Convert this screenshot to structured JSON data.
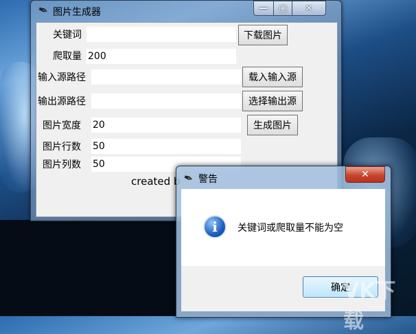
{
  "main_window": {
    "title": "图片生成器",
    "controls": {
      "minimize": "—",
      "maximize": "▢",
      "close": "✕"
    },
    "fields": {
      "keyword": {
        "label": "关键词",
        "value": ""
      },
      "crawl_count": {
        "label": "爬取量",
        "value": "200"
      },
      "input_path": {
        "label": "输入源路径",
        "value": ""
      },
      "output_path": {
        "label": "输出源路径",
        "value": ""
      },
      "image_width": {
        "label": "图片宽度",
        "value": "20"
      },
      "image_rows": {
        "label": "图片行数",
        "value": "50"
      },
      "image_cols": {
        "label": "图片列数",
        "value": "50"
      }
    },
    "buttons": {
      "download": "下载图片",
      "load_input": "载入输入源",
      "select_output": "选择输出源",
      "generate": "生成图片"
    },
    "credit": "created b"
  },
  "dialog": {
    "title": "警告",
    "close": "✕",
    "message": "关键词或爬取量不能为空",
    "info_glyph": "i",
    "ok": "确定"
  },
  "icons": {
    "app": "feather-icon",
    "dialog_info": "info-icon"
  },
  "watermark": "VK下载"
}
